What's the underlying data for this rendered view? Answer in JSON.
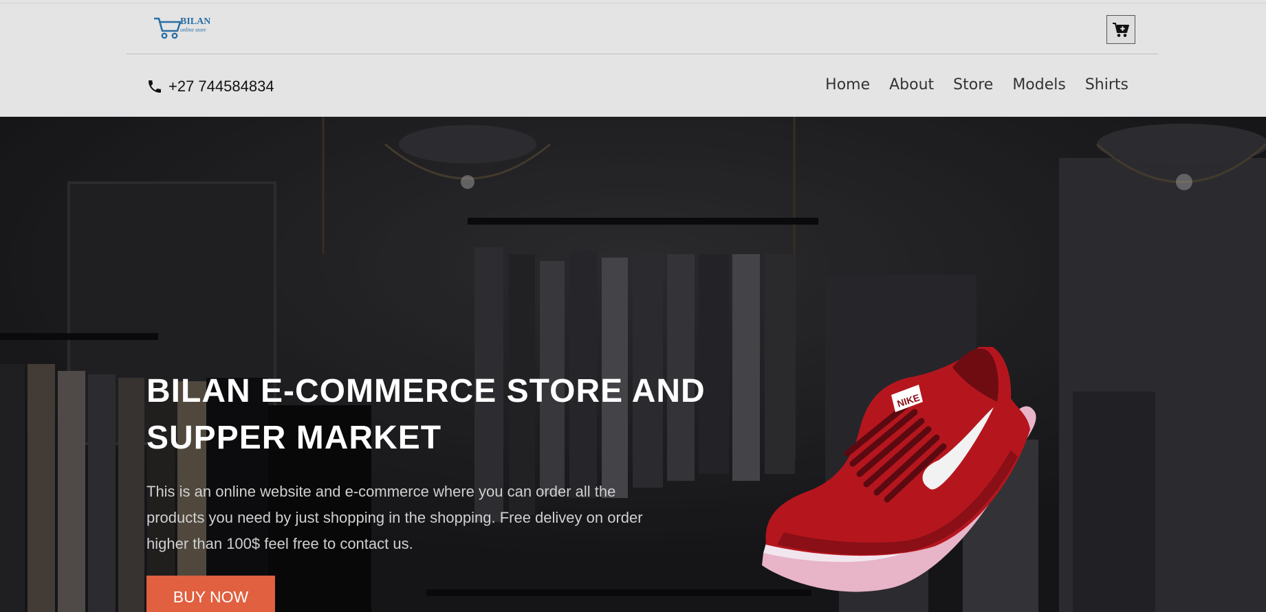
{
  "header": {
    "logo": {
      "text": "BILAN",
      "subtext": "online store",
      "icon": "shopping-cart-logo-icon"
    },
    "cart_button": {
      "icon": "cart-plus-icon"
    },
    "phone": {
      "icon": "phone-icon",
      "number": "+27 744584834"
    },
    "nav": [
      {
        "label": "Home"
      },
      {
        "label": "About"
      },
      {
        "label": "Store"
      },
      {
        "label": "Models"
      },
      {
        "label": "Shirts"
      }
    ]
  },
  "hero": {
    "title": "BILAN E-COMMERCE STORE AND SUPPER MARKET",
    "description": "This is an online website and e-commerce where you can order all the products you need by just shopping in the shopping. Free delivey on order higher than 100$ feel free to contact us.",
    "button_label": "BUY NOW",
    "product_brand": "NIKE",
    "colors": {
      "button": "#e06040",
      "shoe": "#b5161e"
    }
  }
}
